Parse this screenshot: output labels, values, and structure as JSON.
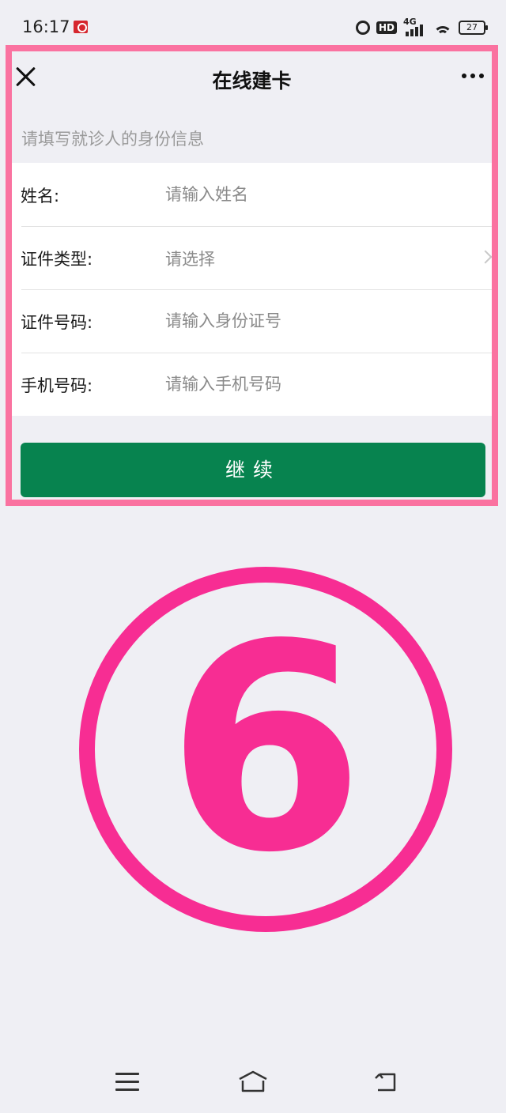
{
  "status_bar": {
    "time": "16:17",
    "network": "4G",
    "battery": "27"
  },
  "nav": {
    "title": "在线建卡"
  },
  "form": {
    "hint": "请填写就诊人的身份信息",
    "rows": [
      {
        "label": "姓名:",
        "placeholder": "请输入姓名"
      },
      {
        "label": "证件类型:",
        "value": "请选择"
      },
      {
        "label": "证件号码:",
        "placeholder": "请输入身份证号"
      },
      {
        "label": "手机号码:",
        "placeholder": "请输入手机号码"
      }
    ]
  },
  "buttons": {
    "continue_label": "继续"
  },
  "step": {
    "number": "6"
  },
  "colors": {
    "primary": "#07834f",
    "highlight": "#fa72a0",
    "step_marker": "#f72d93",
    "background": "#efeff4"
  }
}
